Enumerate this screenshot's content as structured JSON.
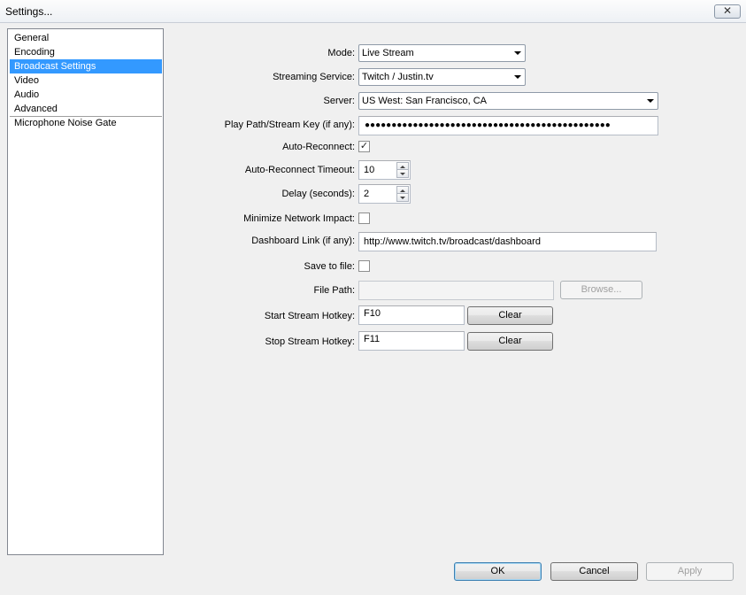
{
  "window": {
    "title": "Settings...",
    "close_glyph": "✕"
  },
  "sidebar": {
    "items": [
      {
        "label": "General"
      },
      {
        "label": "Encoding"
      },
      {
        "label": "Broadcast Settings",
        "selected": true
      },
      {
        "label": "Video"
      },
      {
        "label": "Audio"
      },
      {
        "label": "Advanced"
      },
      {
        "label": "Microphone Noise Gate"
      }
    ]
  },
  "form": {
    "mode": {
      "label": "Mode:",
      "value": "Live Stream"
    },
    "service": {
      "label": "Streaming Service:",
      "value": "Twitch / Justin.tv"
    },
    "server": {
      "label": "Server:",
      "value": "US West: San Francisco, CA"
    },
    "stream_key": {
      "label": "Play Path/Stream Key (if any):",
      "value": "●●●●●●●●●●●●●●●●●●●●●●●●●●●●●●●●●●●●●●●●●●●●●●"
    },
    "auto_reconnect": {
      "label": "Auto-Reconnect:",
      "checked": true,
      "glyph": "✓"
    },
    "reconnect_timeout": {
      "label": "Auto-Reconnect Timeout:",
      "value": "10"
    },
    "delay": {
      "label": "Delay (seconds):",
      "value": "2"
    },
    "minimize_network": {
      "label": "Minimize Network Impact:",
      "checked": false
    },
    "dashboard_link": {
      "label": "Dashboard Link (if any):",
      "value": "http://www.twitch.tv/broadcast/dashboard"
    },
    "save_to_file": {
      "label": "Save to file:",
      "checked": false
    },
    "file_path": {
      "label": "File Path:",
      "value": "",
      "browse_label": "Browse..."
    },
    "start_hotkey": {
      "label": "Start Stream Hotkey:",
      "value": "F10",
      "clear_label": "Clear"
    },
    "stop_hotkey": {
      "label": "Stop Stream Hotkey:",
      "value": "F11",
      "clear_label": "Clear"
    }
  },
  "footer": {
    "ok_label": "OK",
    "cancel_label": "Cancel",
    "apply_label": "Apply"
  }
}
